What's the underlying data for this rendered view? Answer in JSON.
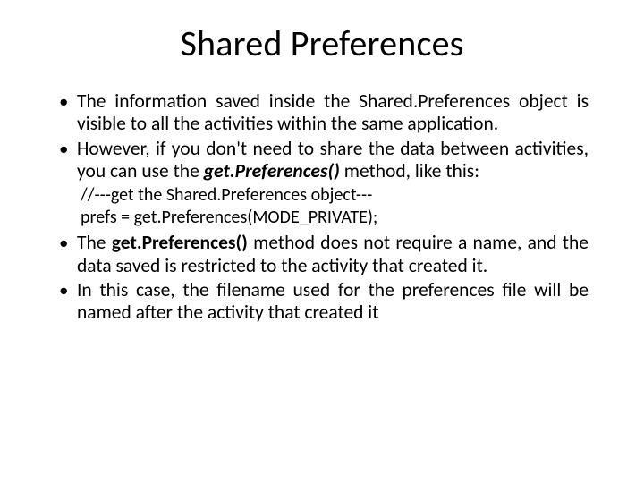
{
  "title": "Shared Preferences",
  "bullets": {
    "b1_pre": "The information saved inside the Shared.Preferences object is visible to all the activities within the same application.",
    "b2_pre": "However, if you don't need to share the data between activities, you can use the ",
    "b2_method": "get.Preferences()",
    "b2_post": " method, like this:",
    "code_line1": "//---get the Shared.Preferences object---",
    "code_line2": "prefs = get.Preferences(MODE_PRIVATE);",
    "b3_pre": "The ",
    "b3_method": "get.Preferences()",
    "b3_post": " method does not require a name, and the data saved is restricted to the activity that created it.",
    "b4": "In this case, the filename used for the preferences file will be named after the activity that created it"
  }
}
